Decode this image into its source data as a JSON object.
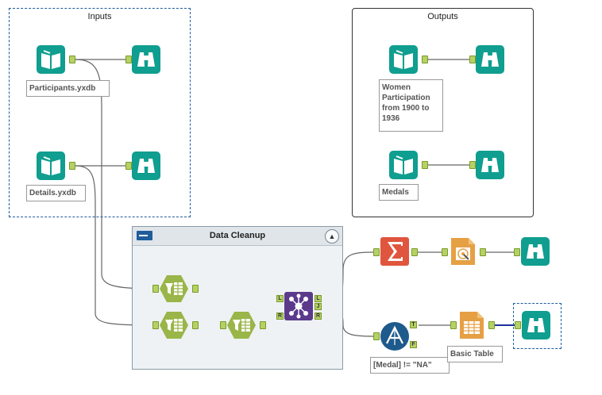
{
  "canvas": {
    "containers": {
      "inputs": {
        "title": "Inputs"
      },
      "outputs": {
        "title": "Outputs"
      },
      "data_cleanup": {
        "title": "Data Cleanup",
        "collapse_glyph": "▲"
      }
    },
    "tools": {
      "input_participants": {
        "annotation": "Participants.yxdb",
        "icon": "book-icon"
      },
      "input_details": {
        "annotation": "Details.yxdb",
        "icon": "book-icon"
      },
      "output_women": {
        "annotation": "Women Participation from 1900 to 1936",
        "icon": "book-icon"
      },
      "output_medals": {
        "annotation": "Medals",
        "icon": "book-icon"
      },
      "browse_icon": "binoculars-icon",
      "select_icon": "select-icon",
      "join_icon": "join-icon",
      "summarize_icon": "sigma-icon",
      "interactive_chart_icon": "chart-icon",
      "filter": {
        "annotation": "[Medal] != \"NA\"",
        "icon": "filter-icon"
      },
      "basic_table": {
        "annotation": "Basic Table",
        "icon": "table-icon"
      }
    },
    "anchor_labels": {
      "left": "L",
      "right": "R",
      "join": "J",
      "true": "T",
      "false": "F"
    },
    "colors": {
      "input_output": "#0f9e8f",
      "browse": "#0f9e8f",
      "select": "#9ab548",
      "join": "#5b3a8c",
      "summarize": "#e0553d",
      "chart": "#e6a044",
      "filter": "#1e5a8c",
      "table": "#e6a044",
      "container_border": "#1f5c9c"
    }
  }
}
